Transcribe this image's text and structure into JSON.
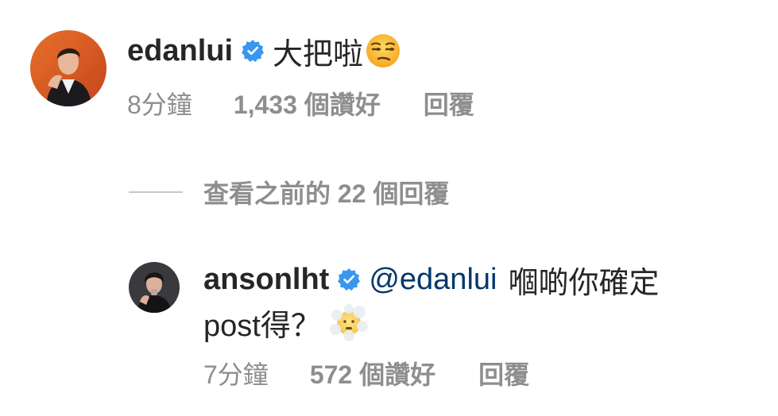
{
  "comments": [
    {
      "username": "edanlui",
      "verified": true,
      "text": "大把啦",
      "emoji": "unamused-face",
      "time": "8分鐘",
      "likes": "1,433 個讚好",
      "reply_label": "回覆"
    },
    {
      "username": "ansonlht",
      "verified": true,
      "mention": "@edanlui",
      "text_line1": "嗰啲你確定",
      "text_line2": "post得？",
      "emoji": "face-in-clouds",
      "time": "7分鐘",
      "likes": "572 個讚好",
      "reply_label": "回覆"
    }
  ],
  "view_replies": {
    "label": "查看之前的 22 個回覆"
  },
  "colors": {
    "text": "#262626",
    "secondary": "#8e8e8e",
    "mention": "#00376b",
    "verified": "#3897f0"
  }
}
